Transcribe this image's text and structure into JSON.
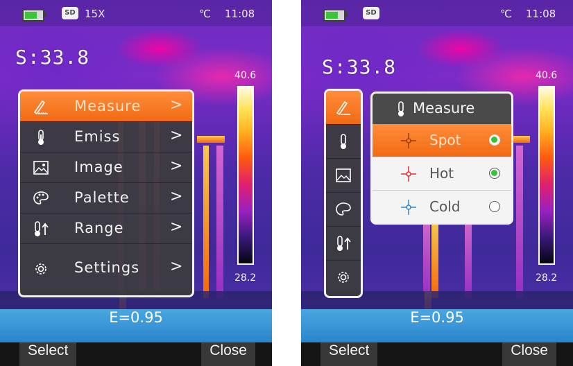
{
  "screens": [
    {
      "status": {
        "zoom": "15X",
        "unit": "℃",
        "time": "11:08"
      },
      "spot_reading": "S:33.8",
      "scale": {
        "max": "40.6",
        "min": "28.2"
      },
      "emissivity": "E=0.95",
      "softkeys": {
        "left": "Select",
        "right": "Close"
      },
      "menu": [
        {
          "label": "Measure",
          "arrow": ">",
          "icon": "measure-pen-icon",
          "active": true
        },
        {
          "label": "Emiss",
          "arrow": ">",
          "icon": "thermometer-icon",
          "active": false
        },
        {
          "label": "Image",
          "arrow": ">",
          "icon": "image-icon",
          "active": false
        },
        {
          "label": "Palette",
          "arrow": ">",
          "icon": "palette-icon",
          "active": false
        },
        {
          "label": "Range",
          "arrow": ">",
          "icon": "range-icon",
          "active": false
        },
        {
          "label": "Settings",
          "arrow": ">",
          "icon": "gear-icon",
          "active": false
        }
      ]
    },
    {
      "status": {
        "unit": "℃",
        "time": "11:08"
      },
      "spot_reading": "S:33.8",
      "scale": {
        "max": "40.6",
        "min": "28.2"
      },
      "emissivity": "E=0.95",
      "softkeys": {
        "left": "Select",
        "right": "Close"
      },
      "rail_icons": [
        "measure-pen-icon",
        "thermometer-icon",
        "image-icon",
        "palette-icon",
        "range-icon",
        "gear-icon"
      ],
      "submenu": {
        "title": "Measure",
        "items": [
          {
            "label": "Spot",
            "cursor_color": "#c0392b",
            "checked": true,
            "active": true
          },
          {
            "label": "Hot",
            "cursor_color": "#e03030",
            "checked": true,
            "active": false
          },
          {
            "label": "Cold",
            "cursor_color": "#2a86cc",
            "checked": false,
            "active": false
          }
        ]
      }
    }
  ],
  "colors": {
    "accent": "#f26a14",
    "ebar": "#2a86cc",
    "panel": "#3c3c3c"
  }
}
